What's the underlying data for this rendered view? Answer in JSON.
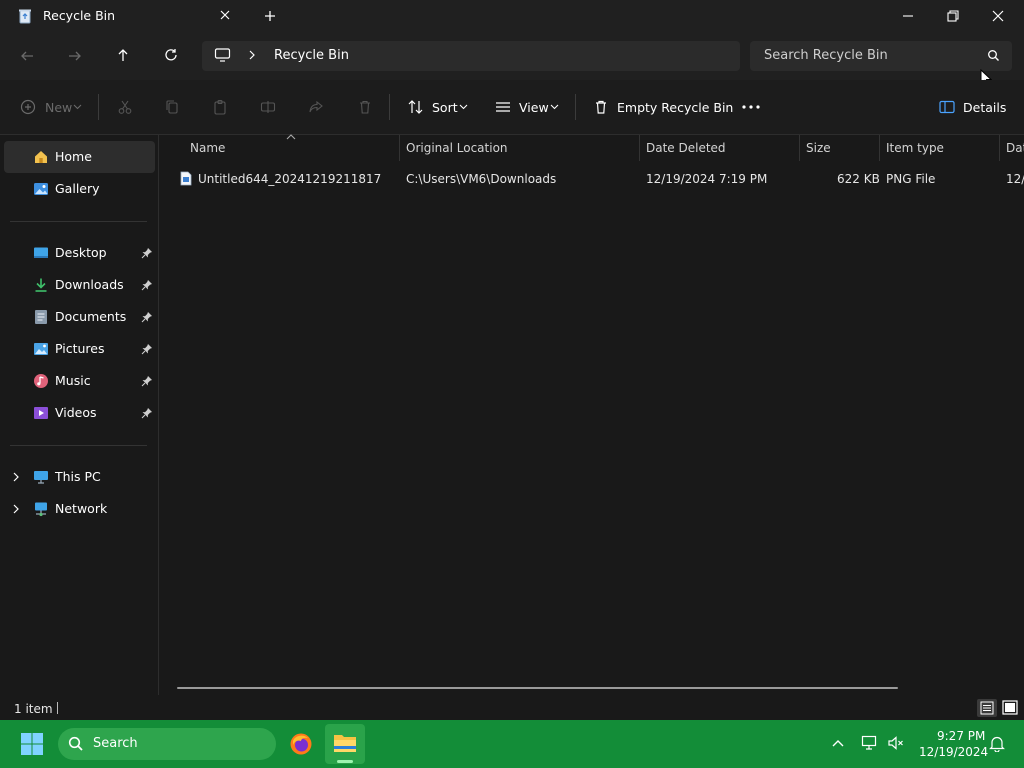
{
  "window": {
    "tab_title": "Recycle Bin"
  },
  "address": {
    "location": "Recycle Bin",
    "search_placeholder": "Search Recycle Bin"
  },
  "toolbar": {
    "new_label": "New",
    "sort_label": "Sort",
    "view_label": "View",
    "empty_label": "Empty Recycle Bin",
    "details_label": "Details"
  },
  "sidebar": {
    "home": "Home",
    "gallery": "Gallery",
    "desktop": "Desktop",
    "downloads": "Downloads",
    "documents": "Documents",
    "pictures": "Pictures",
    "music": "Music",
    "videos": "Videos",
    "this_pc": "This PC",
    "network": "Network"
  },
  "columns": {
    "name": "Name",
    "original_location": "Original Location",
    "date_deleted": "Date Deleted",
    "size": "Size",
    "item_type": "Item type",
    "date_modified": "Dat"
  },
  "rows": [
    {
      "name": "Untitled644_20241219211817",
      "original_location": "C:\\Users\\VM6\\Downloads",
      "date_deleted": "12/19/2024 7:19 PM",
      "size": "622 KB",
      "item_type": "PNG File",
      "date_modified": "12/"
    }
  ],
  "status": {
    "item_count": "1 item"
  },
  "taskbar": {
    "search_label": "Search",
    "time": "9:27 PM",
    "date": "12/19/2024"
  },
  "colors": {
    "taskbar_green": "#138d38",
    "accent_blue": "#4aa3ff"
  }
}
